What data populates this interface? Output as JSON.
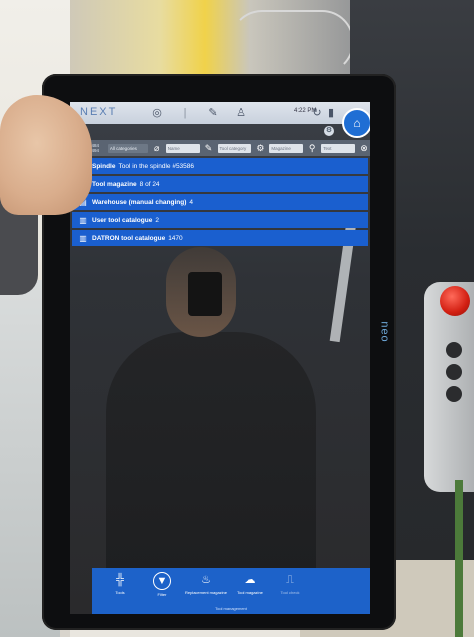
{
  "app": {
    "brand": "NEXT",
    "time": "4:22 PM",
    "header_icons": [
      "target-icon",
      "edit-icon",
      "person-icon",
      "refresh-icon",
      "signal-icon"
    ]
  },
  "filter_bar": {
    "count": "1484\n1494",
    "category": "All categories",
    "name_placeholder": "Name",
    "tool_category_placeholder": "Tool category",
    "magazine_placeholder": "Magazine",
    "search_placeholder": "Text"
  },
  "list": [
    {
      "icon": "spindle-icon",
      "title": "Spindle",
      "value": "Tool in the spindle #53586"
    },
    {
      "icon": "magazine-icon",
      "title": "Tool magazine",
      "value": "8 of 24"
    },
    {
      "icon": "warehouse-icon",
      "title": "Warehouse (manual changing)",
      "value": "4"
    },
    {
      "icon": "catalogue-icon",
      "title": "User tool catalogue",
      "value": "2"
    },
    {
      "icon": "catalogue-icon",
      "title": "DATRON tool catalogue",
      "value": "1470"
    }
  ],
  "bottom_nav": {
    "items": [
      {
        "icon": "tool-icon",
        "label": "Tools",
        "active": false
      },
      {
        "icon": "filter-icon",
        "label": "Filter",
        "active": true
      },
      {
        "icon": "replacement-icon",
        "label": "Replacement magazine",
        "active": false
      },
      {
        "icon": "tool-magazine-icon",
        "label": "Tool magazine",
        "active": false
      },
      {
        "icon": "tool-check-icon",
        "label": "Tool check",
        "active": false
      }
    ],
    "caption": "Tool management"
  },
  "device": {
    "side_logo": "neo"
  },
  "colors": {
    "accent": "#1a5fcf",
    "header": "#c9d1dd",
    "filter_bar": "#5a6472",
    "estop": "#d21f12"
  }
}
